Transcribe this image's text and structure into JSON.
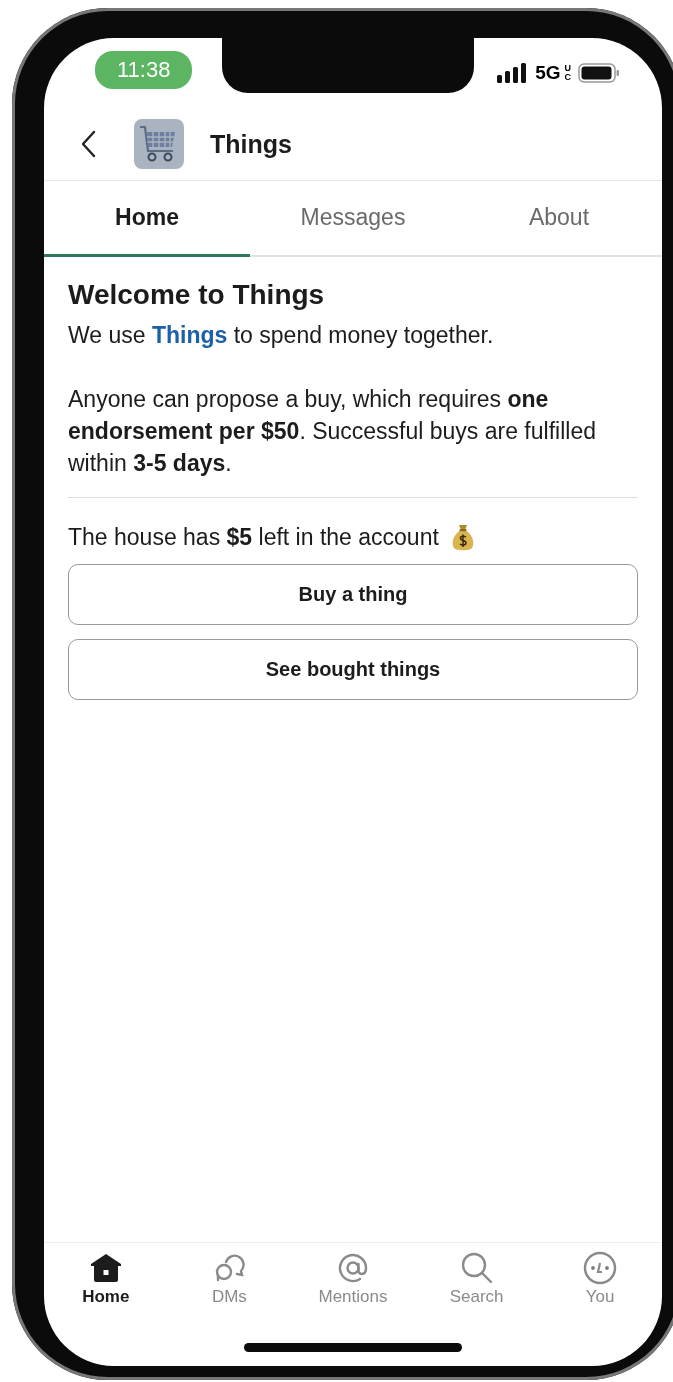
{
  "status_bar": {
    "time": "11:38",
    "network": "5G",
    "network_badge": "UC"
  },
  "header": {
    "title": "Things"
  },
  "tabs": [
    {
      "label": "Home",
      "selected": true
    },
    {
      "label": "Messages",
      "selected": false
    },
    {
      "label": "About",
      "selected": false
    }
  ],
  "welcome": {
    "heading": "Welcome to Things",
    "intro_before": "We use",
    "intro_link": "Things",
    "intro_after": "to spend money together.",
    "rules": "Anyone can propose a buy, which requires **one endorsement per $50**. Successful buys are fulfilled within **3-5 days**."
  },
  "balance": "The house has **$5** left in the account",
  "buttons": [
    "Buy a thing",
    "See bought things"
  ],
  "nav": [
    {
      "kind": "home",
      "label": "Home",
      "selected": true
    },
    {
      "kind": "dms",
      "label": "DMs",
      "selected": false
    },
    {
      "kind": "mentions",
      "label": "Mentions",
      "selected": false
    },
    {
      "kind": "search",
      "label": "Search",
      "selected": false
    },
    {
      "kind": "you",
      "label": "You",
      "selected": false
    }
  ]
}
